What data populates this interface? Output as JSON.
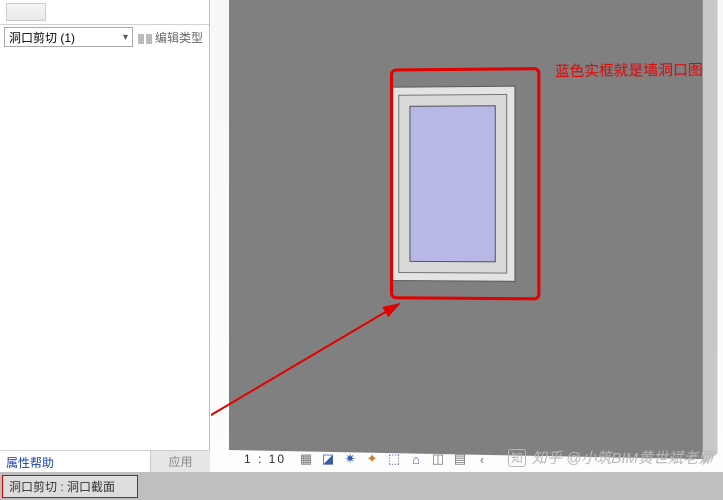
{
  "sidebar": {
    "type_selector": {
      "value": "洞口剪切 (1)"
    },
    "edit_type_label": "编辑类型",
    "help_link": "属性帮助",
    "apply_label": "应用"
  },
  "annotation": {
    "text": "蓝色实框就是墙洞口图元"
  },
  "view_toolbar": {
    "scale": "1 : 10"
  },
  "watermark": {
    "text": "知乎 @小筑BIM黄世斌老师",
    "logo": "知"
  },
  "statusbar": {
    "text": "洞口剪切 : 洞口截面"
  }
}
